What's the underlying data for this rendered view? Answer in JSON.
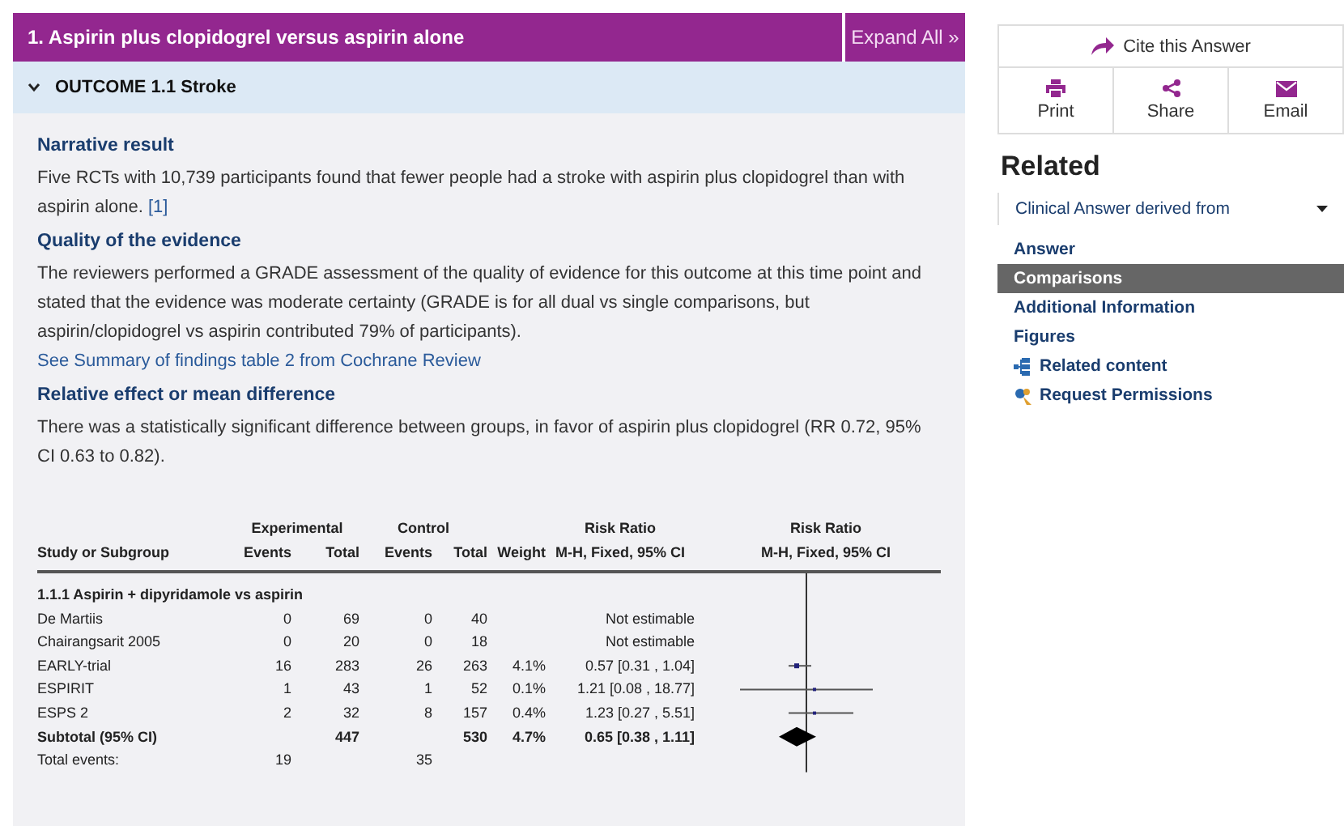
{
  "header": {
    "title": "1. Aspirin plus clopidogrel versus aspirin alone",
    "expand_button": "Expand All »"
  },
  "outcome": {
    "label": "OUTCOME 1.1 Stroke",
    "expanded": true
  },
  "sections": [
    {
      "heading": "Narrative result",
      "text": "Five RCTs with 10,739 participants found that fewer people had a stroke with aspirin plus clopidogrel than with aspirin alone.",
      "link": "[1]"
    },
    {
      "heading": "Quality of the evidence",
      "text": "The reviewers performed a GRADE assessment of the quality of evidence for this outcome at this time point and stated that the evidence was moderate certainty (GRADE is for all dual vs single comparisons, but aspirin/clopidogrel vs aspirin contributed 79% of participants).",
      "link": "See Summary of findings table 2 from Cochrane Review"
    },
    {
      "heading": "Relative effect or mean difference",
      "text": "There was a statistically significant difference between groups, in favor of aspirin plus clopidogrel (RR 0.72, 95% CI 0.63 to 0.82)."
    }
  ],
  "forest_table": {
    "group_headers": [
      "Experimental",
      "Control",
      "Risk Ratio",
      "Risk Ratio"
    ],
    "columns": [
      "Study or Subgroup",
      "Events",
      "Total",
      "Events",
      "Total",
      "Weight",
      "M-H, Fixed, 95% CI",
      "M-H, Fixed, 95% CI"
    ],
    "rows": [
      {
        "kind": "subgroup",
        "cells": [
          "1.1.1 Aspirin + dipyridamole vs aspirin"
        ]
      },
      {
        "kind": "study",
        "cells": [
          "De Martiis",
          "0",
          "69",
          "0",
          "40",
          "",
          "Not estimable"
        ]
      },
      {
        "kind": "study",
        "cells": [
          "Chairangsarit 2005",
          "0",
          "20",
          "0",
          "18",
          "",
          "Not estimable"
        ]
      },
      {
        "kind": "study",
        "cells": [
          "EARLY-trial",
          "16",
          "283",
          "26",
          "263",
          "4.1%",
          "0.57 [0.31 , 1.04]"
        ]
      },
      {
        "kind": "study",
        "cells": [
          "ESPIRIT",
          "1",
          "43",
          "1",
          "52",
          "0.1%",
          "1.21 [0.08 , 18.77]"
        ]
      },
      {
        "kind": "study",
        "cells": [
          "ESPS 2",
          "2",
          "32",
          "8",
          "157",
          "0.4%",
          "1.23 [0.27 , 5.51]"
        ]
      },
      {
        "kind": "subtotal",
        "cells": [
          "Subtotal (95% CI)",
          "",
          "447",
          "",
          "530",
          "4.7%",
          "0.65 [0.38 , 1.11]"
        ]
      },
      {
        "kind": "events",
        "cells": [
          "Total events:",
          "19",
          "",
          "35"
        ]
      }
    ]
  },
  "sidebar": {
    "cite_button": "Cite this Answer",
    "actions": [
      {
        "kind": "print",
        "label": "Print"
      },
      {
        "kind": "share",
        "label": "Share"
      },
      {
        "kind": "email",
        "label": "Email"
      }
    ],
    "related_heading": "Related",
    "dropdown": "Clinical Answer derived from",
    "nav": [
      {
        "kind": "plain",
        "label": "Answer",
        "selected": false
      },
      {
        "kind": "plain",
        "label": "Comparisons",
        "selected": true
      },
      {
        "kind": "plain",
        "label": "Additional Information",
        "selected": false
      },
      {
        "kind": "plain",
        "label": "Figures",
        "selected": false
      },
      {
        "kind": "related",
        "label": "Related content",
        "selected": false
      },
      {
        "kind": "permissions",
        "label": "Request Permissions",
        "selected": false
      }
    ]
  }
}
